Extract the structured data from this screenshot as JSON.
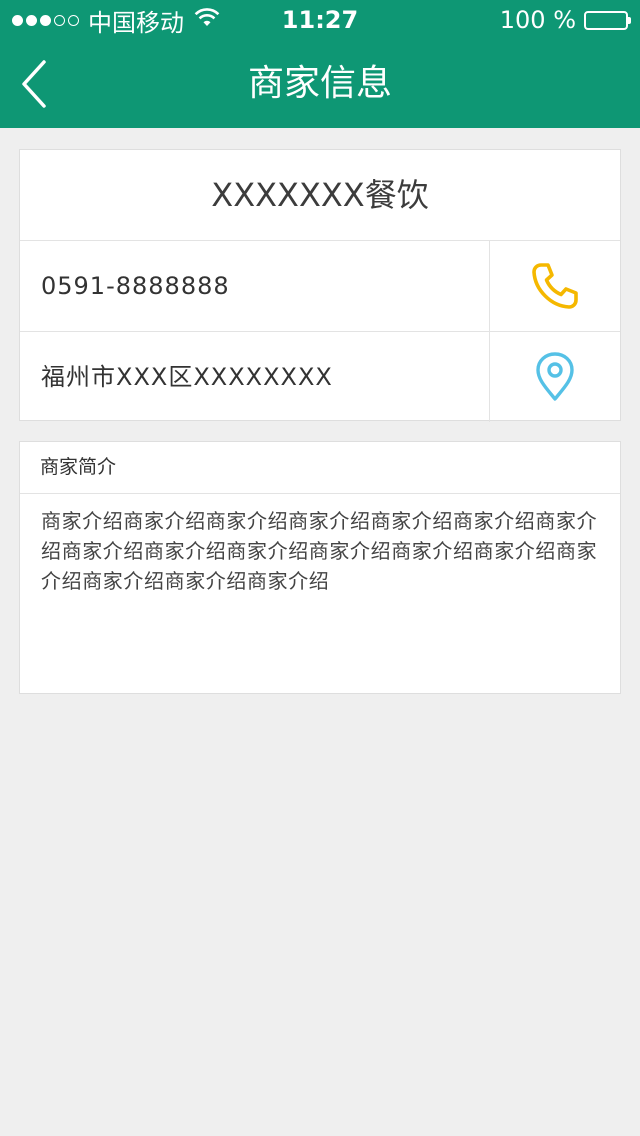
{
  "status_bar": {
    "carrier": "中国移动",
    "time": "11:27",
    "battery_text": "100 %",
    "signal_bars_filled": 3,
    "signal_bars_total": 5
  },
  "nav": {
    "title": "商家信息",
    "back_icon": "chevron-left-icon"
  },
  "merchant": {
    "name": "XXXXXXX餐饮",
    "phone": "0591-8888888",
    "address": "福州市XXX区XXXXXXXX",
    "phone_icon": "phone-icon",
    "location_icon": "location-pin-icon"
  },
  "intro": {
    "heading": "商家简介",
    "text": "商家介绍商家介绍商家介绍商家介绍商家介绍商家介绍商家介绍商家介绍商家介绍商家介绍商家介绍商家介绍商家介绍商家介绍商家介绍商家介绍商家介绍"
  },
  "colors": {
    "primary": "#0e9774",
    "background": "#efefef",
    "phone_icon": "#f5b800",
    "location_icon": "#55c1e6"
  }
}
